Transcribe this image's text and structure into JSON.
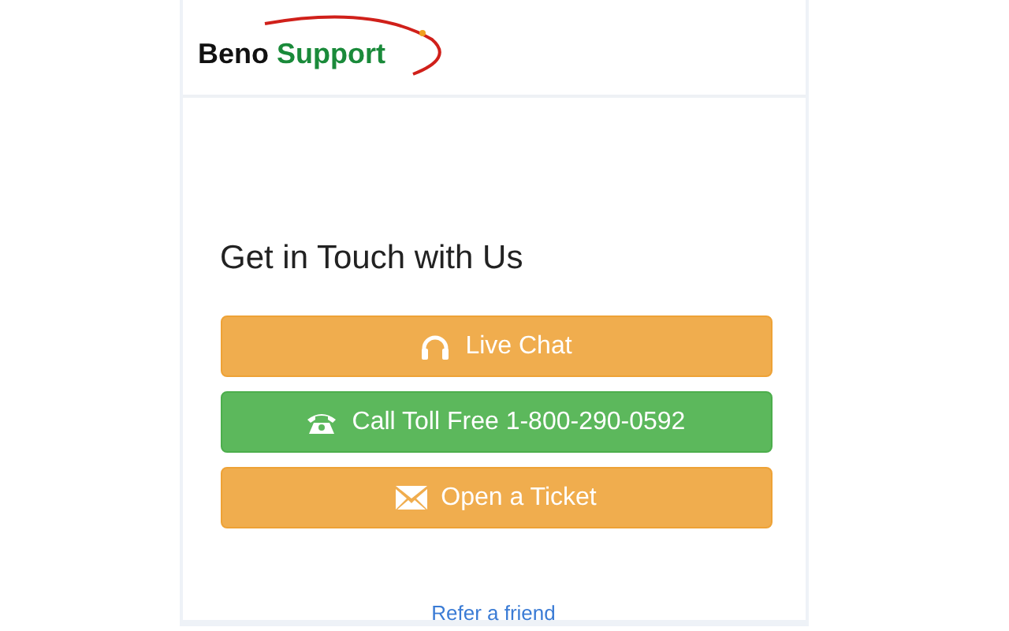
{
  "logo": {
    "first": "Beno",
    "second": "Support"
  },
  "heading": "Get in Touch with Us",
  "buttons": [
    {
      "label": "Live Chat",
      "kind": "warning"
    },
    {
      "label": "Call Toll Free 1-800-290-0592",
      "kind": "success"
    },
    {
      "label": "Open a Ticket",
      "kind": "warning"
    }
  ],
  "footer_link": "Refer a friend"
}
